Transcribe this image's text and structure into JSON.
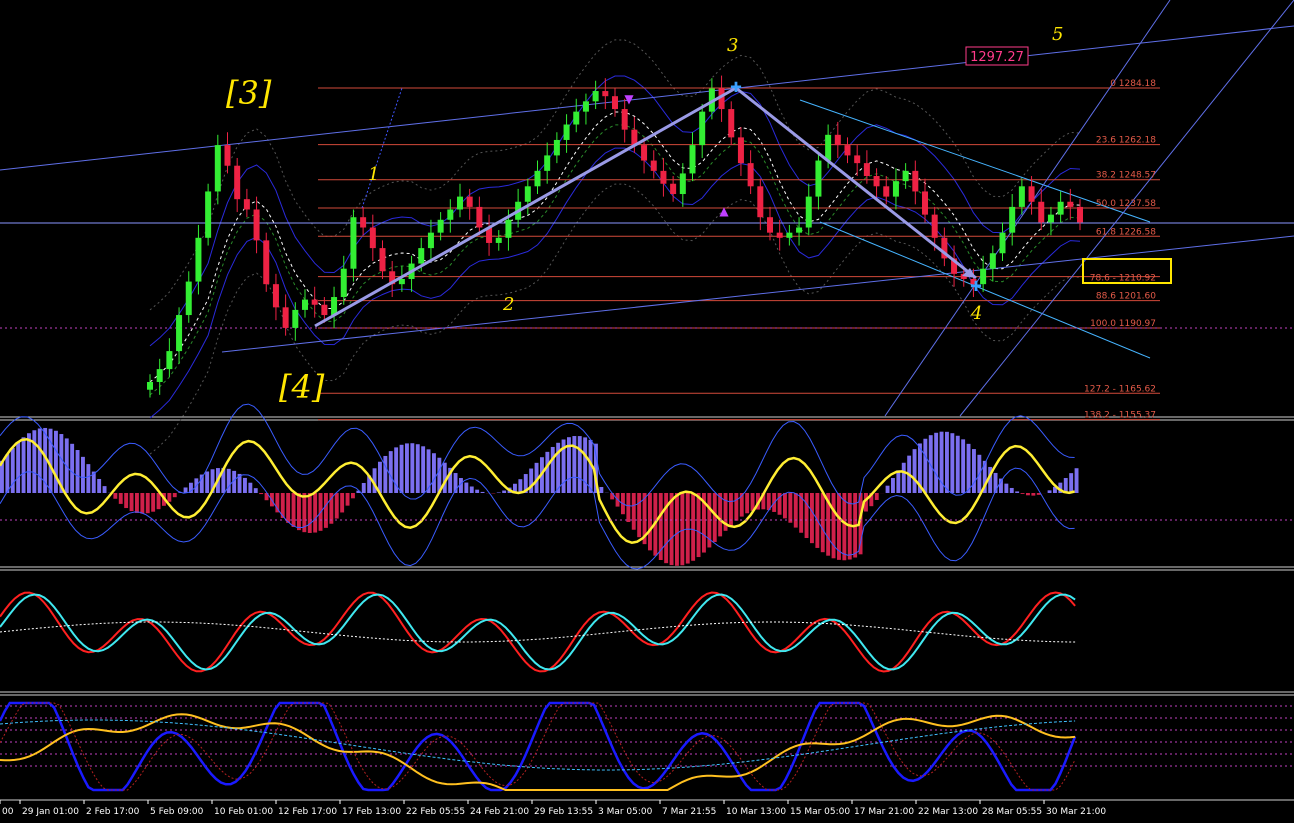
{
  "colors": {
    "background": "#000000",
    "bull_candle": "#33ee33",
    "bear_candle": "#ee2244",
    "fib_line": "#d24a3a",
    "fib_text": "#e35a48",
    "channel": "#6f7df0",
    "wave_label": "#ffe600",
    "price_tag": "#ff3b8a",
    "osc_up": "#7b6ff0",
    "osc_down": "#d0204a",
    "osc_signal": "#ffee33",
    "osc2_fast": "#ff2020",
    "osc2_slow": "#40e8f0",
    "osc3_main": "#1a1aff",
    "osc3_signal": "#ffc020",
    "separator": "#d0d0d0"
  },
  "price_tag": "1297.27",
  "wave_labels": {
    "major_3": "[3]",
    "major_4": "[4]",
    "minor_1": "1",
    "minor_2": "2",
    "minor_3": "3",
    "minor_4": "4",
    "minor_5": "5"
  },
  "fib_levels": [
    {
      "label": "0 1284.18",
      "price": 1284.18
    },
    {
      "label": "23.6 1262.18",
      "price": 1262.18
    },
    {
      "label": "38.2 1248.57",
      "price": 1248.57
    },
    {
      "label": "50.0 1237.58",
      "price": 1237.58
    },
    {
      "label": "61.8 1226.58",
      "price": 1226.58
    },
    {
      "label": "78.6 - 1210.92",
      "price": 1210.92,
      "highlighted": true
    },
    {
      "label": "88.6 1201.60",
      "price": 1201.6
    },
    {
      "label": "100.0 1190.97",
      "price": 1190.97
    },
    {
      "label": "127.2 - 1165.62",
      "price": 1165.62
    },
    {
      "label": "138.2 - 1155.37",
      "price": 1155.37
    }
  ],
  "time_axis": [
    "00",
    "29 Jan 01:00",
    "2 Feb 17:00",
    "5 Feb 09:00",
    "10 Feb 01:00",
    "12 Feb 17:00",
    "17 Feb 13:00",
    "22 Feb 05:55",
    "24 Feb 21:00",
    "29 Feb 13:55",
    "3 Mar 05:00",
    "7 Mar 21:55",
    "10 Mar 13:00",
    "15 Mar 05:00",
    "17 Mar 21:00",
    "22 Mar 13:00",
    "28 Mar 05:55",
    "30 Mar 21:00"
  ],
  "chart_data": {
    "type": "candlestick",
    "ylim": [
      1150,
      1300
    ],
    "grid": false,
    "wave_pivots": [
      {
        "label": "[4]",
        "price": 1190.97
      },
      {
        "label": "3",
        "price": 1284.18
      },
      {
        "label": "4",
        "price": 1208
      }
    ],
    "close_trace": [
      1170,
      1175,
      1182,
      1196,
      1209,
      1226,
      1244,
      1262,
      1254,
      1241,
      1237,
      1225,
      1208,
      1199,
      1191,
      1198,
      1202,
      1200,
      1196,
      1203,
      1214,
      1234,
      1230,
      1222,
      1213,
      1208,
      1210,
      1216,
      1222,
      1228,
      1233,
      1237,
      1242,
      1238,
      1230,
      1224,
      1226,
      1233,
      1240,
      1246,
      1252,
      1258,
      1264,
      1270,
      1275,
      1279,
      1283,
      1281,
      1276,
      1268,
      1262,
      1256,
      1252,
      1247,
      1243,
      1251,
      1262,
      1275,
      1284,
      1276,
      1265,
      1255,
      1246,
      1234,
      1228,
      1226,
      1228,
      1230,
      1242,
      1256,
      1266,
      1262,
      1258,
      1255,
      1250,
      1246,
      1242,
      1248,
      1252,
      1244,
      1235,
      1226,
      1218,
      1212,
      1210,
      1208,
      1214,
      1220,
      1228,
      1238,
      1246,
      1240,
      1232,
      1235,
      1240,
      1238,
      1232
    ]
  }
}
